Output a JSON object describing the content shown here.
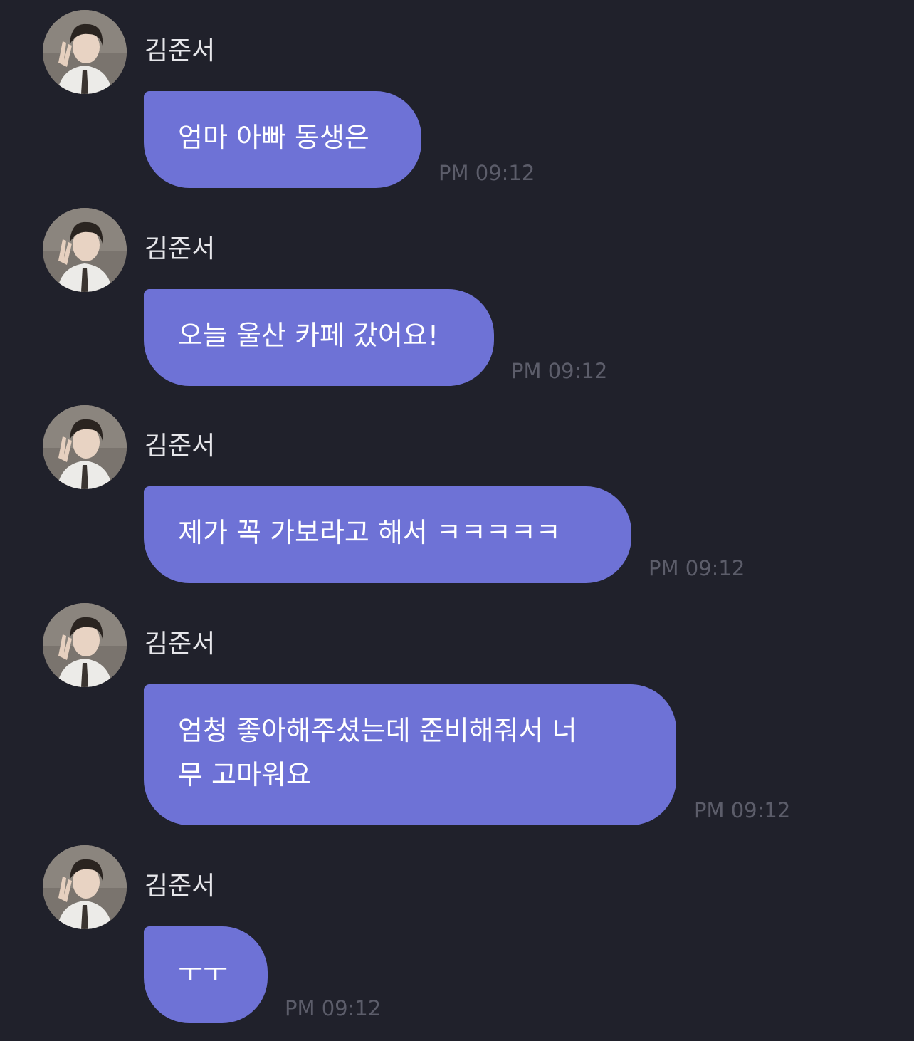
{
  "chat": {
    "messages": [
      {
        "sender": "김준서",
        "text": "엄마 아빠 동생은",
        "time": "PM 09:12"
      },
      {
        "sender": "김준서",
        "text": "오늘 울산 카페 갔어요!",
        "time": "PM 09:12"
      },
      {
        "sender": "김준서",
        "text": "제가 꼭 가보라고 해서 ㅋㅋㅋㅋㅋ",
        "time": "PM 09:12"
      },
      {
        "sender": "김준서",
        "text": "엄청 좋아해주셨는데 준비해줘서 너\n무 고마워요",
        "time": "PM 09:12"
      },
      {
        "sender": "김준서",
        "text": "ㅜㅜ",
        "time": "PM 09:12"
      }
    ]
  }
}
